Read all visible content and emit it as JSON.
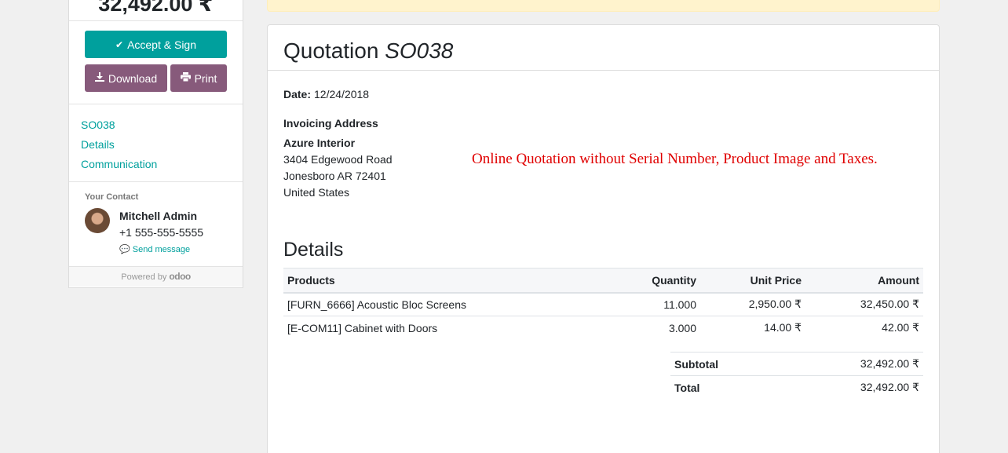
{
  "sidebar": {
    "total": "32,492.00 ₹",
    "accept_label": "Accept & Sign",
    "download_label": "Download",
    "print_label": "Print",
    "nav": [
      "SO038",
      "Details",
      "Communication"
    ],
    "contact": {
      "label": "Your Contact",
      "name": "Mitchell Admin",
      "phone": "+1 555-555-5555",
      "send_message": "Send message"
    },
    "powered_by": "Powered by",
    "logo_text": "odoo"
  },
  "quotation": {
    "title_prefix": "Quotation",
    "number": "SO038",
    "date_label": "Date:",
    "date_value": "12/24/2018",
    "invoicing_label": "Invoicing Address",
    "address": {
      "name": "Azure Interior",
      "line1": "3404 Edgewood Road",
      "line2": "Jonesboro AR 72401",
      "line3": "United States"
    },
    "note": "Online Quotation without Serial Number, Product Image and Taxes.",
    "details_title": "Details",
    "columns": [
      "Products",
      "Quantity",
      "Unit Price",
      "Amount"
    ],
    "lines": [
      {
        "product": "[FURN_6666] Acoustic Bloc Screens",
        "quantity": "11.000",
        "unit_price": "2,950.00 ₹",
        "amount": "32,450.00 ₹"
      },
      {
        "product": "[E-COM11] Cabinet with Doors",
        "quantity": "3.000",
        "unit_price": "14.00 ₹",
        "amount": "42.00 ₹"
      }
    ],
    "subtotal_label": "Subtotal",
    "subtotal_value": "32,492.00 ₹",
    "total_label": "Total",
    "total_value": "32,492.00 ₹"
  },
  "colors": {
    "accent": "#00a09d",
    "secondary": "#875a7b",
    "note": "#e00000",
    "alert_bg": "#fff3cd"
  }
}
